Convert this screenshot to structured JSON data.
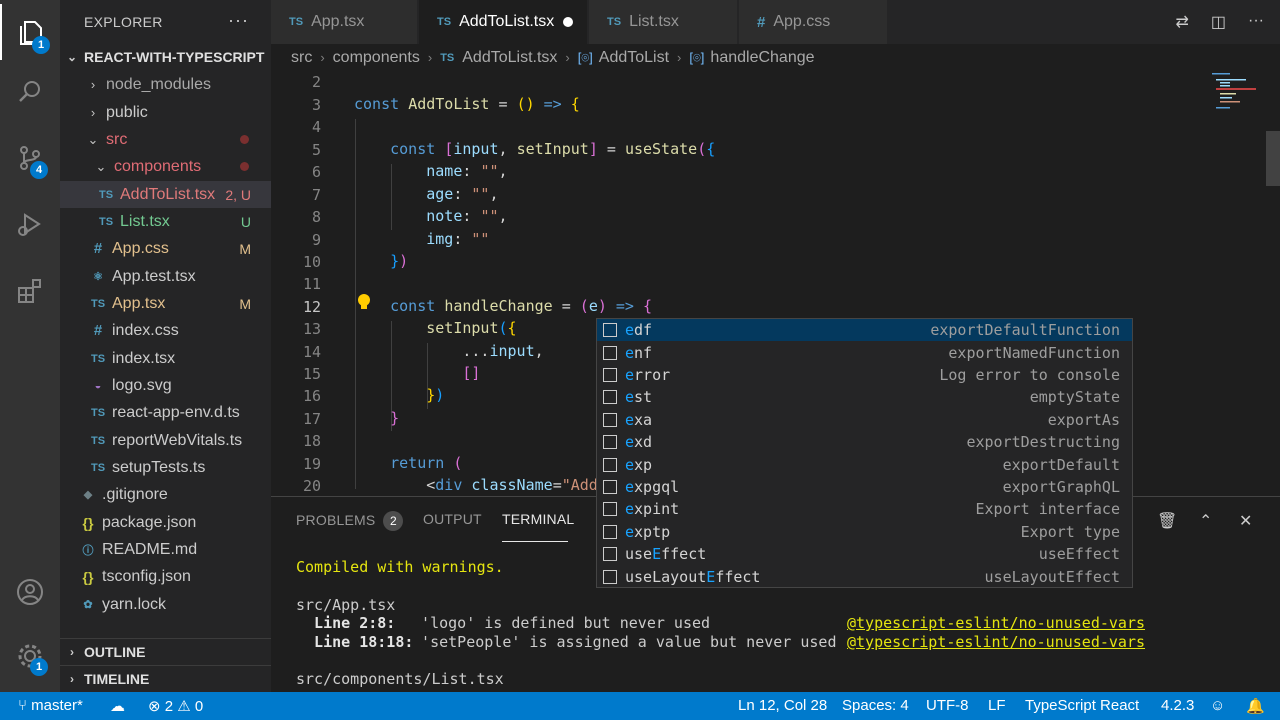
{
  "activity_bar": {
    "explorer_badge": "1",
    "scm_badge": "4",
    "settings_badge": "1"
  },
  "sidebar": {
    "title": "EXPLORER",
    "more": "···",
    "project": "REACT-WITH-TYPESCRIPT",
    "outline": "OUTLINE",
    "timeline": "TIMELINE",
    "items": [
      {
        "name": "node_modules",
        "icon": "chevron-right"
      },
      {
        "name": "public",
        "icon": "chevron-right"
      },
      {
        "name": "src",
        "icon": "chevron-down"
      },
      {
        "name": "components",
        "icon": "chevron-down"
      },
      {
        "name": "AddToList.tsx",
        "icon": "TS",
        "badge": "2, U"
      },
      {
        "name": "List.tsx",
        "icon": "TS",
        "badge": "U"
      },
      {
        "name": "App.css",
        "icon": "#",
        "badge": "M"
      },
      {
        "name": "App.test.tsx",
        "icon": "react"
      },
      {
        "name": "App.tsx",
        "icon": "TS",
        "badge": "M"
      },
      {
        "name": "index.css",
        "icon": "#"
      },
      {
        "name": "index.tsx",
        "icon": "TS"
      },
      {
        "name": "logo.svg",
        "icon": "svg"
      },
      {
        "name": "react-app-env.d.ts",
        "icon": "TS"
      },
      {
        "name": "reportWebVitals.ts",
        "icon": "TS"
      },
      {
        "name": "setupTests.ts",
        "icon": "TS"
      },
      {
        "name": ".gitignore",
        "icon": "git"
      },
      {
        "name": "package.json",
        "icon": "{}"
      },
      {
        "name": "README.md",
        "icon": "info"
      },
      {
        "name": "tsconfig.json",
        "icon": "{}"
      },
      {
        "name": "yarn.lock",
        "icon": "yarn"
      }
    ]
  },
  "tabs": [
    {
      "label": "App.tsx",
      "icon": "TS"
    },
    {
      "label": "AddToList.tsx",
      "icon": "TS"
    },
    {
      "label": "List.tsx",
      "icon": "TS"
    },
    {
      "label": "App.css",
      "icon": "#"
    }
  ],
  "breadcrumbs": [
    "src",
    "components",
    "AddToList.tsx",
    "AddToList",
    "handleChange"
  ],
  "editor": {
    "line_numbers": [
      "2",
      "3",
      "4",
      "5",
      "6",
      "7",
      "8",
      "9",
      "10",
      "11",
      "12",
      "13",
      "14",
      "15",
      "16",
      "17",
      "18",
      "19",
      "20"
    ]
  },
  "suggest": [
    {
      "prefix": "",
      "match": "e",
      "rest": "df",
      "detail": "exportDefaultFunction"
    },
    {
      "prefix": "",
      "match": "e",
      "rest": "nf",
      "detail": "exportNamedFunction"
    },
    {
      "prefix": "",
      "match": "e",
      "rest": "rror",
      "detail": "Log error to console"
    },
    {
      "prefix": "",
      "match": "e",
      "rest": "st",
      "detail": "emptyState"
    },
    {
      "prefix": "",
      "match": "e",
      "rest": "xa",
      "detail": "exportAs"
    },
    {
      "prefix": "",
      "match": "e",
      "rest": "xd",
      "detail": "exportDestructing"
    },
    {
      "prefix": "",
      "match": "e",
      "rest": "xp",
      "detail": "exportDefault"
    },
    {
      "prefix": "",
      "match": "e",
      "rest": "xpgql",
      "detail": "exportGraphQL"
    },
    {
      "prefix": "",
      "match": "e",
      "rest": "xpint",
      "detail": "Export interface"
    },
    {
      "prefix": "",
      "match": "e",
      "rest": "xptp",
      "detail": "Export type"
    },
    {
      "prefix": "use",
      "match": "E",
      "rest": "ffect",
      "detail": "useEffect"
    },
    {
      "prefix": "useLayout",
      "match": "E",
      "rest": "ffect",
      "detail": "useLayoutEffect"
    }
  ],
  "panel": {
    "tabs": [
      "PROBLEMS",
      "OUTPUT",
      "TERMINAL"
    ],
    "problems_count": "2",
    "terminal_lines": {
      "compiled": "Compiled with warnings.",
      "file1": "src/App.tsx",
      "l1_loc": "  Line 2:8:",
      "l1_msg": "  'logo' is defined but never used",
      "l1_rule": "@typescript-eslint/no-unused-vars",
      "l2_loc": "  Line 18:18:",
      "l2_msg": "  'setPeople' is assigned a value but never used",
      "l2_rule": "@typescript-eslint/no-unused-vars",
      "file2": "src/components/List.tsx"
    }
  },
  "status": {
    "branch": "master*",
    "errors": "2",
    "warnings": "0",
    "position": "Ln 12, Col 28",
    "spaces": "Spaces: 4",
    "encoding": "UTF-8",
    "eol": "LF",
    "language": "TypeScript React",
    "version": "4.2.3"
  },
  "colors": {
    "accent": "#007acc",
    "activity_bar": "#333333",
    "sidebar": "#252526",
    "editor": "#1e1e1e"
  }
}
